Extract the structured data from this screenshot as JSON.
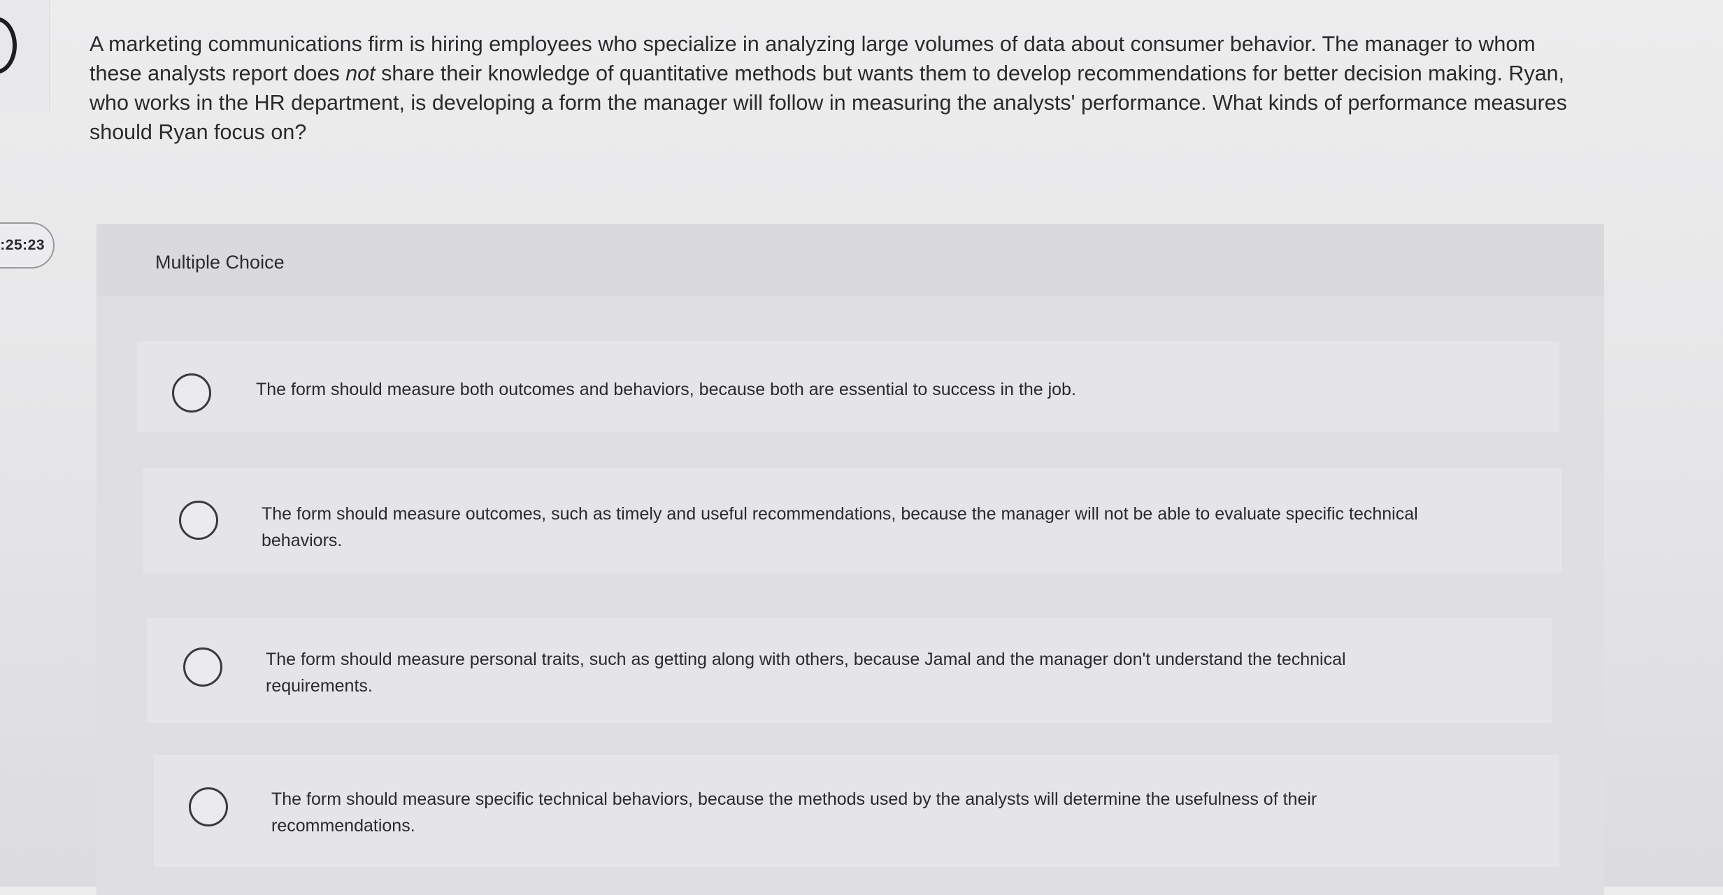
{
  "nav": {
    "previous_icon": "left-arc-icon"
  },
  "timer": {
    "text": ":25:23"
  },
  "question": {
    "text_before": "A marketing communications firm is hiring employees who specialize in analyzing large volumes of data about consumer behavior. The manager to whom these analysts report does ",
    "emphasis": "not",
    "text_after": " share their knowledge of quantitative methods but wants them to develop recommendations for better decision making. Ryan, who works in the HR department, is developing a form the manager will follow in measuring the analysts' performance. What kinds of performance measures should Ryan focus on?"
  },
  "question_type": {
    "label": "Multiple Choice"
  },
  "choices": [
    {
      "text": "The form should measure both outcomes and behaviors, because both are essential to success in the job."
    },
    {
      "text": "The form should measure outcomes, such as timely and useful recommendations, because the manager will not be able to evaluate specific technical behaviors."
    },
    {
      "text": "The form should measure personal traits, such as getting along with others, because Jamal and the manager don't understand the technical requirements."
    },
    {
      "text": "The form should measure specific technical behaviors, because the methods used by the analysts will determine the usefulness of their recommendations."
    }
  ],
  "colors": {
    "page_background": "#e6e6e8",
    "panel_background": "#dfdfe1",
    "choice_background": "#e5e5e7",
    "text": "#2a2a2c"
  }
}
